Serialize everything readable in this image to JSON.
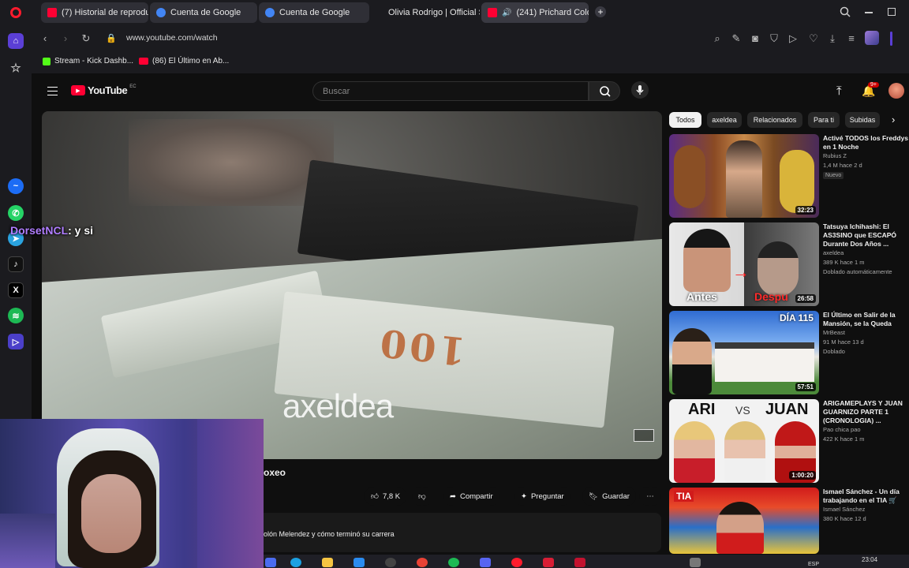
{
  "browser": {
    "tabs": [
      {
        "label": "(7) Historial de reproducci",
        "favicon_color": "#ff0033"
      },
      {
        "label": "Cuenta de Google",
        "favicon_color": "#4285f4"
      },
      {
        "label": "Cuenta de Google",
        "favicon_color": "#4285f4"
      },
      {
        "label": "Olivia Rodrigo | Official Sit",
        "favicon_color": "#222222"
      },
      {
        "label": "(241) Prichard Colón: E",
        "favicon_color": "#ff0033"
      }
    ],
    "url": "www.youtube.com/watch",
    "bookmarks": [
      {
        "label": "Stream - Kick Dashb...",
        "color": "#53fc18"
      },
      {
        "label": "(86) El Último en Ab...",
        "color": "#ff0033"
      }
    ]
  },
  "youtube": {
    "logo_text": "YouTube",
    "region": "EC",
    "search_placeholder": "Buscar",
    "notification_count": "9+"
  },
  "player": {
    "watermark": "axeldea",
    "bill_text": "100"
  },
  "video": {
    "title_fragment": "oxeo",
    "likes": "7,8 K",
    "share_label": "Compartir",
    "ask_label": "Preguntar",
    "save_label": "Guardar",
    "description_fragment": "olón Melendez y cómo terminó su carrera"
  },
  "chat": {
    "username": "DorsetNCL",
    "message": ": y si"
  },
  "chips": [
    "Todos",
    "axeldea",
    "Relacionados",
    "Para ti",
    "Subidas"
  ],
  "recommendations": [
    {
      "title": "Activé TODOS los Freddys en 1 Noche",
      "channel": "Rubius Z",
      "stats": "1,4 M  hace 2 d",
      "badge": "Nuevo",
      "duration": "32:23"
    },
    {
      "title": "Tatsuya Ichihashi: El AS3SINO que ESCAPÓ Durante Dos Años ...",
      "channel": "axeldea",
      "stats": "389 K  hace 1 m",
      "badge": "Doblado automáticamente",
      "duration": "26:58",
      "thumb_left": "Antes",
      "thumb_right": "Despu"
    },
    {
      "title": "El Último en Salir de la Mansión, se la Queda",
      "channel": "MrBeast",
      "stats": "91 M  hace 13 d",
      "badge": "Doblado",
      "duration": "57:51",
      "thumb_tag": "DÍA 115"
    },
    {
      "title": "ARIGAMEPLAYS Y JUAN GUARNIZO PARTE 1 (CRONOLOGIA) ...",
      "channel": "Pao chica pao",
      "stats": "422 K  hace 1 m",
      "badge": "",
      "duration": "1:00:20",
      "thumb_left": "ARI",
      "thumb_mid": "VS",
      "thumb_right": "JUAN"
    },
    {
      "title": "Ismael Sánchez - Un día trabajando en el TIA 🛒",
      "channel": "Ismael Sánchez",
      "stats": "380 K  hace 12 d",
      "badge": "",
      "duration": "",
      "thumb_tag": "TIA"
    }
  ],
  "taskbar": {
    "lang": "ESP",
    "time": "23:04"
  }
}
